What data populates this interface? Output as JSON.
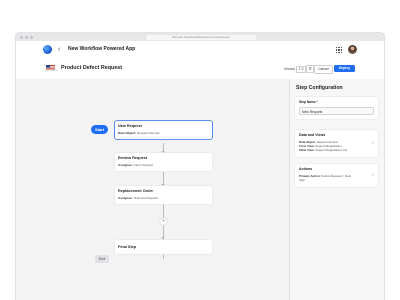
{
  "browser": {
    "url": "lifecycle.cloud/workflows/new-powered-app"
  },
  "appbar": {
    "title": "New Workflow Powered App"
  },
  "header": {
    "title": "Product Defect Request",
    "flag_caption": "UNITED STATES",
    "version_label": "Version",
    "version_value": "1.0",
    "cancel_label": "Cancel",
    "deploy_label": "Deploy"
  },
  "flow": {
    "start_label": "Start",
    "end_label": "End",
    "steps": [
      {
        "marker": "Start",
        "title": "New Request",
        "sub_key": "Data Object:",
        "sub_val": "Request Service"
      },
      {
        "marker": "1",
        "title": "Review Request",
        "sub_key": "Assignee:",
        "sub_val": "Client Support"
      },
      {
        "marker": "2",
        "title": "Replacement Order",
        "sub_key": "Assignee:",
        "sub_val": "Technical Support"
      },
      {
        "marker": "End",
        "title": "Final Step"
      }
    ],
    "add_icon": "plus-icon"
  },
  "panel": {
    "title": "Step Configuration",
    "step_name_label": "Step Name *",
    "step_name_value": "New Request",
    "data_views": {
      "title": "Data and Views",
      "rows": [
        {
          "key": "Data Object:",
          "val": "Request Service"
        },
        {
          "key": "Form View:",
          "val": "Support Registration"
        },
        {
          "key": "Table View:",
          "val": "Support Registration List"
        }
      ]
    },
    "actions": {
      "title": "Actions",
      "rows": [
        {
          "key": "Primary Action:",
          "val": "Submit Request > Next"
        },
        {
          "key": "",
          "val": "Step"
        }
      ]
    }
  },
  "colors": {
    "accent": "#1f6df2",
    "canvas": "#f3f3f4"
  }
}
